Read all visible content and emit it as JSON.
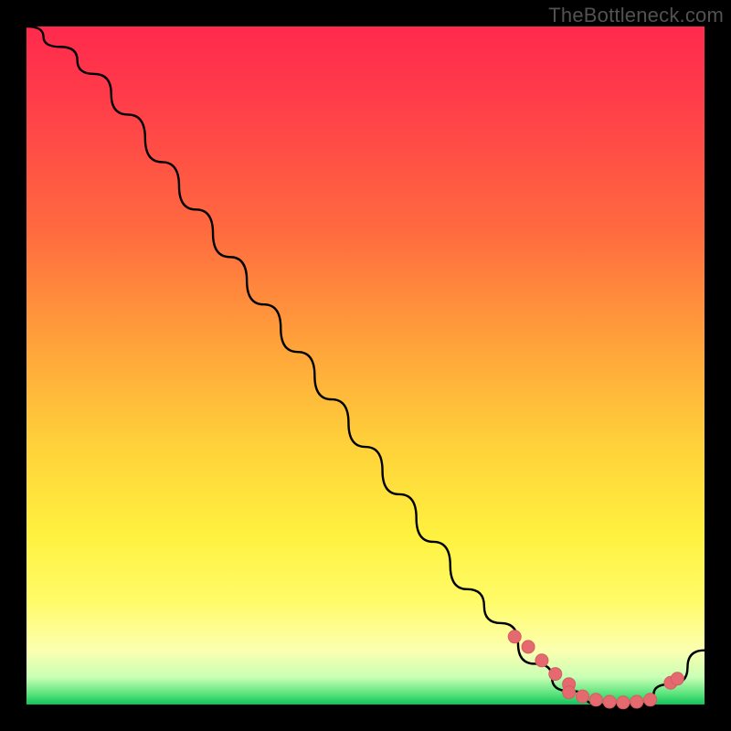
{
  "watermark": "TheBottleneck.com",
  "colors": {
    "background": "#000000",
    "curve": "#000000",
    "marker_fill": "#e46a6f",
    "marker_stroke": "#d65c61",
    "gradient_top": "#ff2a4d",
    "gradient_bottom": "#0fc35b"
  },
  "chart_data": {
    "type": "line",
    "title": "",
    "xlabel": "",
    "ylabel": "",
    "xlim": [
      0,
      100
    ],
    "ylim": [
      0,
      100
    ],
    "x": [
      0,
      5,
      10,
      15,
      20,
      25,
      30,
      35,
      40,
      45,
      50,
      55,
      60,
      65,
      70,
      75,
      80,
      85,
      90,
      95,
      100
    ],
    "values": [
      100,
      97,
      93,
      87,
      80,
      73,
      66,
      59,
      52,
      45,
      38,
      31,
      24,
      17,
      12,
      6,
      2,
      0,
      0,
      3,
      8
    ],
    "marker_segments": [
      {
        "x": [
          72,
          74,
          76,
          78,
          80
        ],
        "y": [
          10,
          8.5,
          6.5,
          4.5,
          3
        ]
      },
      {
        "x": [
          80,
          82,
          84,
          86,
          88,
          90,
          92
        ],
        "y": [
          1.8,
          1.2,
          0.7,
          0.4,
          0.3,
          0.4,
          0.7
        ]
      },
      {
        "x": [
          95,
          96
        ],
        "y": [
          3.2,
          3.8
        ]
      }
    ]
  }
}
